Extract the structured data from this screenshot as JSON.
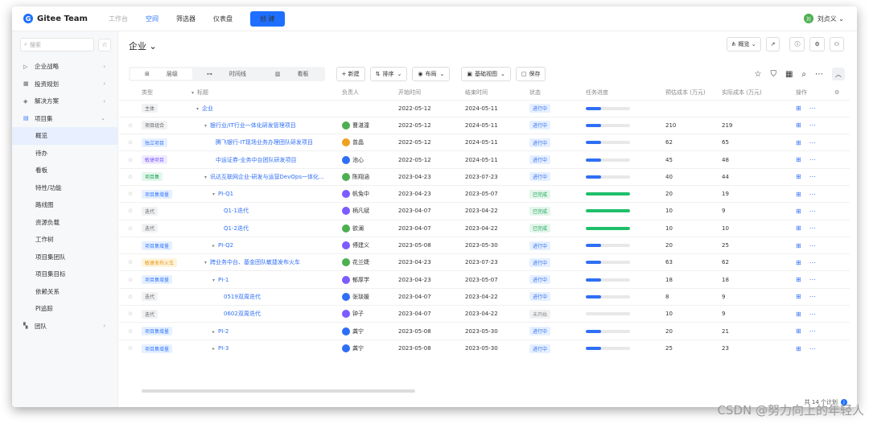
{
  "app": {
    "logo": "Gitee Team"
  },
  "nav": {
    "items": [
      "工作台",
      "空间",
      "筛选器",
      "仪表盘"
    ],
    "create": "创 建"
  },
  "user": {
    "avatar": "刘",
    "name": "刘贞义 ⌄"
  },
  "sidebar": {
    "search_placeholder": "搜索",
    "items": [
      {
        "label": "企业战略"
      },
      {
        "label": "投资规划"
      },
      {
        "label": "解决方案"
      },
      {
        "label": "项目集"
      }
    ],
    "sub_items": [
      "概览",
      "待办",
      "看板",
      "特性/功能",
      "路线图",
      "资源负载",
      "工作树",
      "项目集团队",
      "项目集目标",
      "依赖关系",
      "PI追踪"
    ],
    "team": "团队"
  },
  "page": {
    "title": "企业 ⌄",
    "overview_btn": "概览 ⌄"
  },
  "toolbar": {
    "views": [
      "层级",
      "时间线",
      "看板"
    ],
    "new": "+ 新建",
    "sort": "排序",
    "layout": "布局",
    "baseline": "基础视图",
    "save": "保存"
  },
  "columns": [
    "类型",
    "标题",
    "负责人",
    "开始时间",
    "结束时间",
    "状态",
    "任务进度",
    "预估成本 (万元)",
    "实际成本 (万元)",
    "操作"
  ],
  "rows": [
    {
      "type": "主体",
      "tc": "t-gray",
      "caret": "▾",
      "indent": 0,
      "title": "企业",
      "link": true,
      "owner": "",
      "oc": "",
      "start": "2022-05-12",
      "end": "2024-05-11",
      "status": "进行中",
      "sc": "s-run",
      "prog": 0.35,
      "pc": "#2f6ff5",
      "est": "",
      "act": "",
      "star": false
    },
    {
      "type": "项目组合",
      "tc": "t-gray",
      "caret": "▾",
      "indent": 1,
      "title": "银行业/IT行业一体化研发管理项目",
      "link": true,
      "owner": "曹湛潼",
      "oc": "#4caf50",
      "start": "2022-05-12",
      "end": "2024-05-11",
      "status": "进行中",
      "sc": "s-run",
      "prog": 0.35,
      "pc": "#2f6ff5",
      "est": "210",
      "act": "219",
      "star": true
    },
    {
      "type": "独立项目",
      "tc": "t-blue",
      "caret": "",
      "indent": 2,
      "title": "腾飞银行-IT现场业务办理团队研发项目",
      "link": true,
      "owner": "曾晶",
      "oc": "#f0a020",
      "start": "2022-05-12",
      "end": "2024-05-11",
      "status": "进行中",
      "sc": "s-run",
      "prog": 0.35,
      "pc": "#2f6ff5",
      "est": "62",
      "act": "65",
      "star": true
    },
    {
      "type": "敏捷项目",
      "tc": "t-purple",
      "caret": "",
      "indent": 2,
      "title": "中运证券-业务中台团队研发项目",
      "link": true,
      "owner": "池心",
      "oc": "#2f6ff5",
      "start": "2022-05-12",
      "end": "2024-05-11",
      "status": "进行中",
      "sc": "s-run",
      "prog": 0.35,
      "pc": "#2f6ff5",
      "est": "45",
      "act": "48",
      "star": true
    },
    {
      "type": "项目集",
      "tc": "t-green",
      "caret": "▾",
      "indent": 1,
      "title": "讯达互联网企业-研发与运营DevOps一体化...",
      "link": true,
      "owner": "陈翔涵",
      "oc": "#4caf50",
      "start": "2023-04-23",
      "end": "2023-07-23",
      "status": "进行中",
      "sc": "s-run",
      "prog": 0.35,
      "pc": "#2f6ff5",
      "est": "40",
      "act": "44",
      "star": true
    },
    {
      "type": "项目集增量",
      "tc": "t-blue",
      "caret": "▾",
      "indent": 2,
      "title": "PI-Q1",
      "link": true,
      "owner": "帆兔中",
      "oc": "#7c5cff",
      "start": "2023-04-23",
      "end": "2023-05-07",
      "status": "已完成",
      "sc": "s-done",
      "prog": 1,
      "pc": "#1fbf6a",
      "est": "20",
      "act": "19",
      "star": true
    },
    {
      "type": "迭代",
      "tc": "t-gray",
      "caret": "",
      "indent": 3,
      "title": "Q1-1迭代",
      "link": true,
      "owner": "柄凡斌",
      "oc": "#7c5cff",
      "start": "2023-04-07",
      "end": "2023-04-22",
      "status": "已完成",
      "sc": "s-done",
      "prog": 1,
      "pc": "#1fbf6a",
      "est": "10",
      "act": "9",
      "star": true
    },
    {
      "type": "迭代",
      "tc": "t-gray",
      "caret": "",
      "indent": 3,
      "title": "Q1-2迭代",
      "link": true,
      "owner": "欲澜",
      "oc": "#4caf50",
      "start": "2023-04-07",
      "end": "2023-04-22",
      "status": "已完成",
      "sc": "s-done",
      "prog": 1,
      "pc": "#1fbf6a",
      "est": "10",
      "act": "10",
      "star": true
    },
    {
      "type": "项目集增量",
      "tc": "t-blue",
      "caret": "▸",
      "indent": 2,
      "title": "PI-Q2",
      "link": true,
      "owner": "傅建义",
      "oc": "#7c5cff",
      "start": "2023-05-08",
      "end": "2023-05-30",
      "status": "进行中",
      "sc": "s-run",
      "prog": 0.35,
      "pc": "#2f6ff5",
      "est": "20",
      "act": "25",
      "star": false
    },
    {
      "type": "敏捷发布火车",
      "tc": "t-orange",
      "caret": "▾",
      "indent": 1,
      "title": "跨业务中台、基金团队敏捷发布火车",
      "link": true,
      "owner": "花兰婕",
      "oc": "#4caf50",
      "start": "2023-04-23",
      "end": "2023-07-23",
      "status": "进行中",
      "sc": "s-run",
      "prog": 0.35,
      "pc": "#2f6ff5",
      "est": "63",
      "act": "62",
      "star": true
    },
    {
      "type": "项目集增量",
      "tc": "t-blue",
      "caret": "▾",
      "indent": 2,
      "title": "PI-1",
      "link": true,
      "owner": "郁厚学",
      "oc": "#7c5cff",
      "start": "2023-04-23",
      "end": "2023-05-07",
      "status": "进行中",
      "sc": "s-run",
      "prog": 0.35,
      "pc": "#2f6ff5",
      "est": "18",
      "act": "18",
      "star": true
    },
    {
      "type": "迭代",
      "tc": "t-gray",
      "caret": "",
      "indent": 3,
      "title": "0519双周迭代",
      "link": true,
      "owner": "张琰媛",
      "oc": "#2f6ff5",
      "start": "2023-04-07",
      "end": "2023-04-22",
      "status": "进行中",
      "sc": "s-run",
      "prog": 0.35,
      "pc": "#2f6ff5",
      "est": "8",
      "act": "9",
      "star": true
    },
    {
      "type": "迭代",
      "tc": "t-gray",
      "caret": "",
      "indent": 3,
      "title": "0602双周迭代",
      "link": true,
      "owner": "钟子",
      "oc": "#7c5cff",
      "start": "2023-04-07",
      "end": "2023-04-22",
      "status": "未开始",
      "sc": "s-none",
      "prog": 0,
      "pc": "#2f6ff5",
      "est": "10",
      "act": "9",
      "star": true
    },
    {
      "type": "项目集增量",
      "tc": "t-blue",
      "caret": "▸",
      "indent": 2,
      "title": "PI-2",
      "link": true,
      "owner": "龚宁",
      "oc": "#2f6ff5",
      "start": "2023-05-08",
      "end": "2023-05-30",
      "status": "进行中",
      "sc": "s-run",
      "prog": 0.35,
      "pc": "#2f6ff5",
      "est": "20",
      "act": "21",
      "star": true
    },
    {
      "type": "项目集增量",
      "tc": "t-blue",
      "caret": "▸",
      "indent": 2,
      "title": "PI-3",
      "link": true,
      "owner": "龚宁",
      "oc": "#2f6ff5",
      "start": "2023-05-08",
      "end": "2023-05-30",
      "status": "进行中",
      "sc": "s-run",
      "prog": 0.35,
      "pc": "#2f6ff5",
      "est": "25",
      "act": "23",
      "star": true
    }
  ],
  "footer": {
    "total": "共 14 个计划"
  },
  "watermark": "CSDN @努力向上的年轻人"
}
